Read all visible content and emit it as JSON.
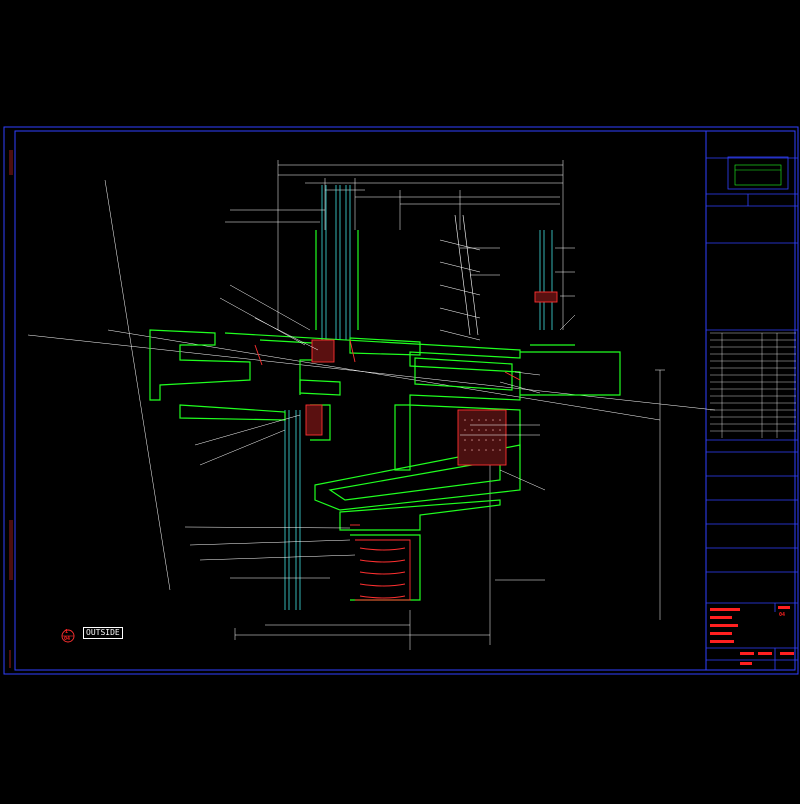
{
  "drawing": {
    "outside_label": "OUTSIDE",
    "section_marker": {
      "number": "1",
      "sheet": "04"
    }
  },
  "colors": {
    "background": "#000000",
    "frame": "#3040ff",
    "profile": "#20ff20",
    "glass": "#40e0e0",
    "sealant": "#ff3030",
    "line": "#ffffff"
  },
  "title_block": {
    "drawing_no": "04"
  }
}
